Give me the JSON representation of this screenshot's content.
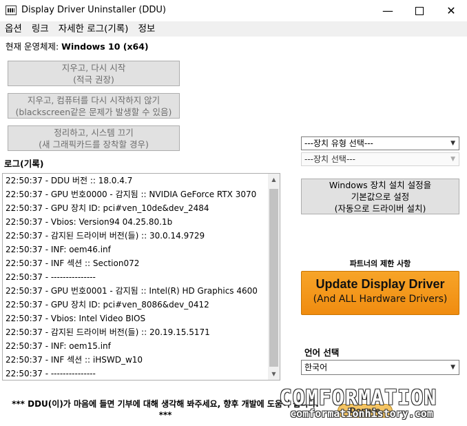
{
  "window": {
    "title": "Display Driver Uninstaller (DDU)",
    "minimize_glyph": "—",
    "close_glyph": "✕"
  },
  "menu": [
    "옵션",
    "링크",
    "자세한 로그(기록)",
    "정보"
  ],
  "os": {
    "label": "현재 운영체제: ",
    "value": "Windows 10 (x64)"
  },
  "actions": {
    "clean_restart": [
      "지우고, 다시 시작",
      "(적극 권장)"
    ],
    "clean_no_restart": [
      "지우고, 컴퓨터를 다시 시작하지 않기",
      "(blackscreen같은 문제가 발생할 수 있음)"
    ],
    "clean_shutdown": [
      "정리하고, 시스템 끄기",
      "(새 그래픽카드를 장착할 경우)"
    ]
  },
  "log": {
    "label": "로그(기록)",
    "lines": [
      "22:50:37 - DDU 버전 :: 18.0.4.7",
      "22:50:37 - GPU 번호0000 - 감지됨 :: NVIDIA GeForce RTX 3070",
      "22:50:37 - GPU 장치 ID: pci#ven_10de&dev_2484",
      "22:50:37 - Vbios: Version94 04.25.80.1b",
      "22:50:37 - 감지된 드라이버 버전(들) :: 30.0.14.9729",
      "22:50:37 - INF: oem46.inf",
      "22:50:37 - INF 섹션 :: Section072",
      "22:50:37 - ---------------",
      "22:50:37 - GPU 번호0001 - 감지됨 :: Intel(R) HD Graphics 4600",
      "22:50:37 - GPU 장치 ID: pci#ven_8086&dev_0412",
      "22:50:37 - Vbios: Intel Video BIOS",
      "22:50:37 - 감지된 드라이버 버전(들) :: 20.19.15.5171",
      "22:50:37 - INF: oem15.inf",
      "22:50:37 - INF 섹션 :: iHSWD_w10",
      "22:50:37 - ---------------"
    ]
  },
  "device_type_select": {
    "value": "---장치 유형 선택---"
  },
  "device_select": {
    "value": "---장치 선택---"
  },
  "windows_default_button": [
    "Windows 장치 설치 설정을",
    "기본값으로 설정",
    "(자동으로 드라이버 설치)"
  ],
  "partner": {
    "label": "파트너의 제한 사항",
    "button_main": "Update Display Driver",
    "button_sub": "(And ALL Hardware Drivers)"
  },
  "language": {
    "label": "언어 선택",
    "value": "한국어"
  },
  "footer": {
    "donate_text_1": "*** DDU(이)가 마음에 들면 기부에 대해 생각해 봐주세요, 향후 개발에 도움이 됩니다.",
    "donate_text_2": "***",
    "donate_button": "Donate"
  },
  "watermark": {
    "main": "COMFORMATION",
    "sub": "comformationhistory.com"
  }
}
